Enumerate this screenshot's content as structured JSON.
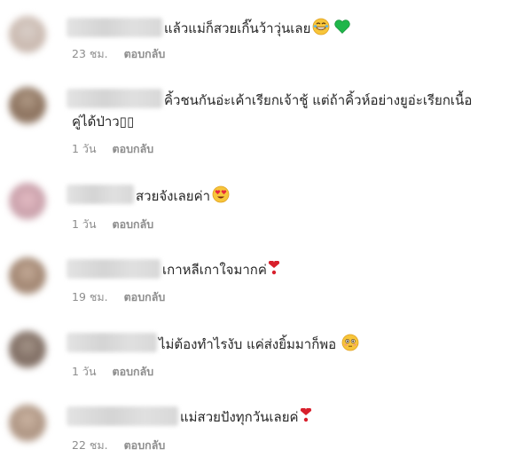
{
  "comments": [
    {
      "text": "แล้วแม่ก็สวยเกิ๊นว้าวุ่นเลย",
      "emoji": [
        "grin-sweat-icon",
        "green-heart-icon"
      ],
      "time": "23 ชม.",
      "reply": "ตอบกลับ"
    },
    {
      "text": "คิ้วชนกันอ่ะเค้าเรียกเจ้าชู้ แต่ถ้าคิ้วห์อย่างยูอ่ะเรียกเนื้อ",
      "text2": "คู่ได้ป่าว▯▯",
      "time": "1 วัน",
      "reply": "ตอบกลับ"
    },
    {
      "text": "สวยจังเลยค่า",
      "emoji": [
        "heart-eyes-icon"
      ],
      "time": "1 วัน",
      "reply": "ตอบกลับ"
    },
    {
      "text": "เกาหลีเกาใจมากค่",
      "emoji": [
        "heart-exclamation-icon"
      ],
      "time": "19 ชม.",
      "reply": "ตอบกลับ"
    },
    {
      "text": "ไม่ต้องทำไรงับ แค่ส่งยิ้มมาก็พอ",
      "emoji": [
        "flushed-face-icon"
      ],
      "time": "1 วัน",
      "reply": "ตอบกลับ"
    },
    {
      "text": "แม่สวยปังทุกวันเลยค่",
      "emoji": [
        "heart-exclamation-icon"
      ],
      "time": "22 ชม.",
      "reply": "ตอบกลับ"
    }
  ]
}
